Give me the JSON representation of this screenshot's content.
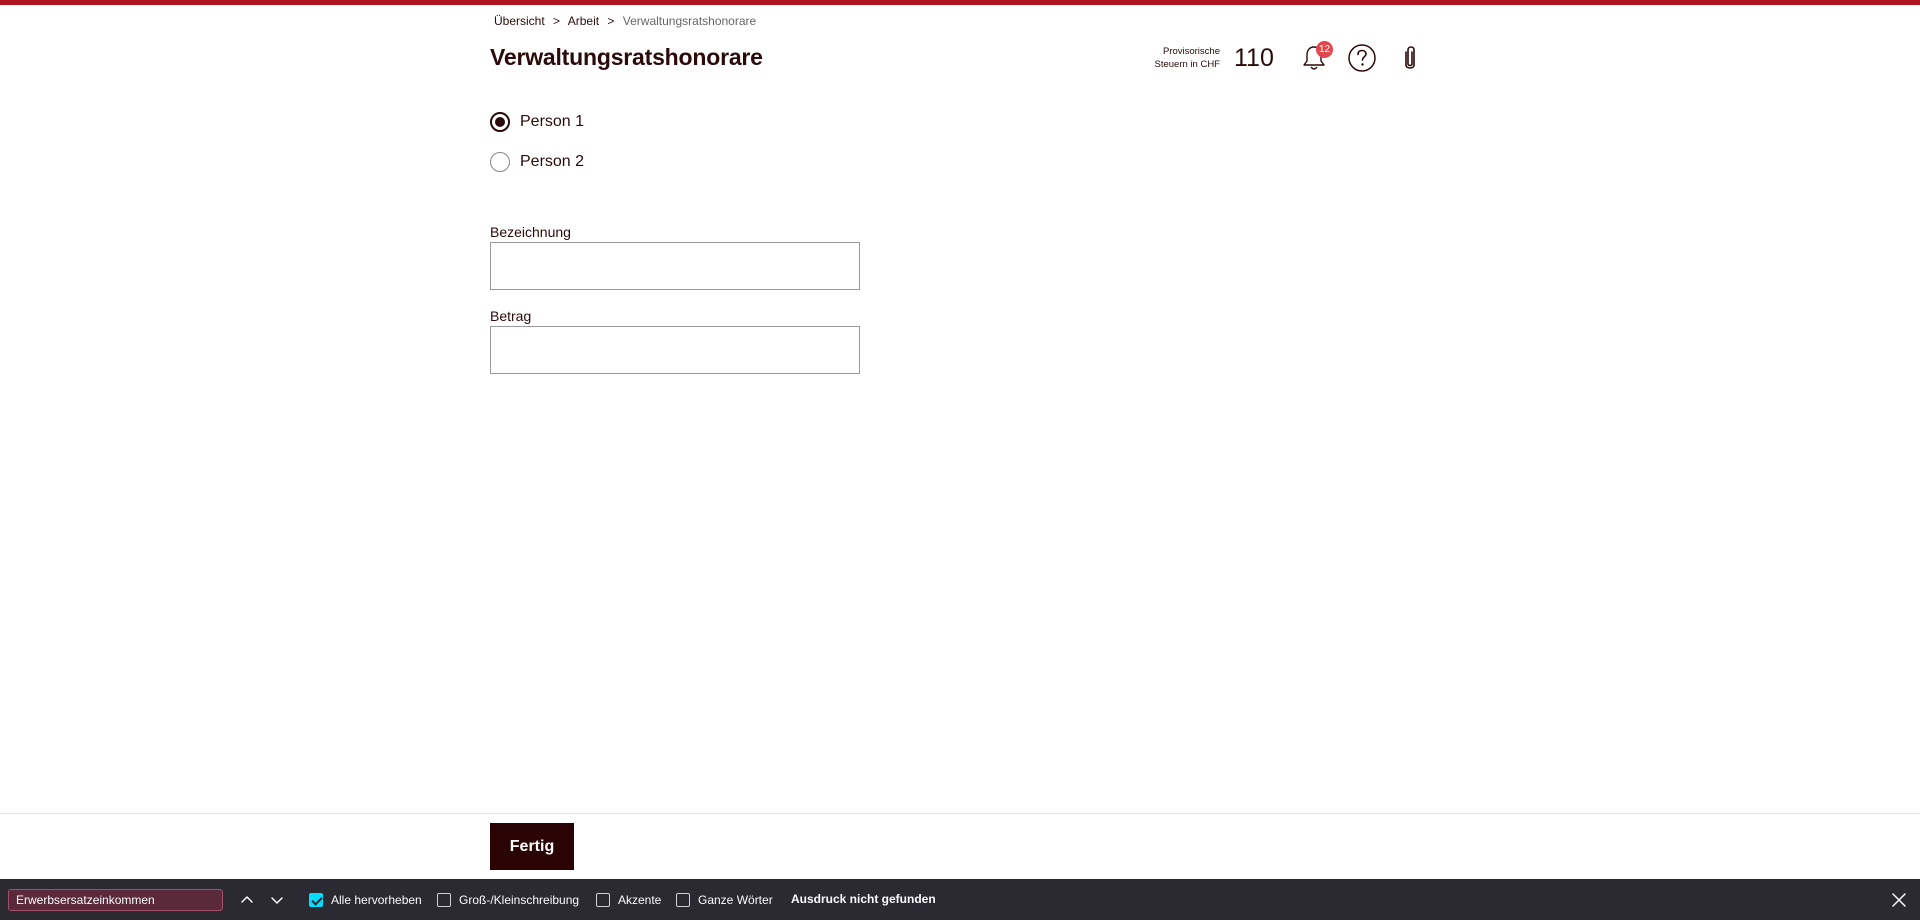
{
  "breadcrumb": {
    "items": [
      "Übersicht",
      "Arbeit"
    ],
    "separator": ">",
    "current": "Verwaltungsratshonorare"
  },
  "page_title": "Verwaltungsratshonorare",
  "header": {
    "tax_label_line1": "Provisorische",
    "tax_label_line2": "Steuern in CHF",
    "tax_value": "110",
    "notification_count": "12"
  },
  "form": {
    "person_options": [
      {
        "label": "Person 1",
        "checked": true
      },
      {
        "label": "Person 2",
        "checked": false
      }
    ],
    "fields": [
      {
        "label": "Bezeichnung",
        "value": ""
      },
      {
        "label": "Betrag",
        "value": ""
      }
    ]
  },
  "footer": {
    "done_label": "Fertig"
  },
  "findbar": {
    "query": "Erwerbsersatzeinkommen",
    "options": [
      {
        "label": "Alle hervorheben",
        "checked": true
      },
      {
        "label": "Groß-/Kleinschreibung",
        "checked": false
      },
      {
        "label": "Akzente",
        "checked": false
      },
      {
        "label": "Ganze Wörter",
        "checked": false
      }
    ],
    "status": "Ausdruck nicht gefunden"
  },
  "colors": {
    "accent_bar": "#b01622",
    "primary_dark": "#2a0404",
    "badge": "#e1474d",
    "findbar_bg": "#2b2a33",
    "checkbox_checked": "#00ddff"
  }
}
